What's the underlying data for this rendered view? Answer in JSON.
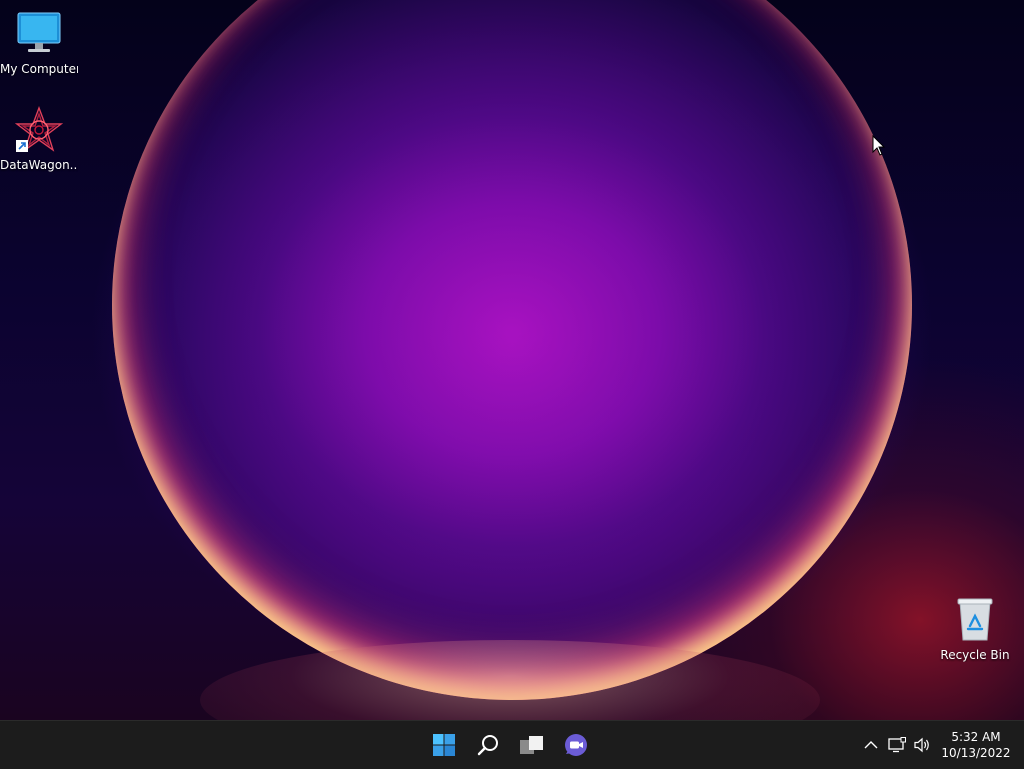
{
  "desktop": {
    "icons": [
      {
        "label": "My Computer",
        "icon": "monitor-icon"
      },
      {
        "label": "DataWagon...",
        "icon": "datawagon-app-icon"
      },
      {
        "label": "Recycle Bin",
        "icon": "recycle-bin-icon"
      }
    ]
  },
  "taskbar": {
    "buttons": [
      {
        "label": "Start",
        "icon": "windows-start-icon"
      },
      {
        "label": "Search",
        "icon": "search-icon"
      },
      {
        "label": "Task View",
        "icon": "task-view-icon"
      },
      {
        "label": "Chat",
        "icon": "chat-video-icon"
      }
    ],
    "tray": {
      "icons": [
        "chevron-up-icon",
        "network-icon",
        "volume-icon"
      ]
    },
    "clock": {
      "time": "5:32 AM",
      "date": "10/13/2022"
    }
  },
  "colors": {
    "accent_start": "#3aa0e8",
    "chat": "#6b5cd6",
    "taskbar_bg": "#1c1c1c"
  }
}
